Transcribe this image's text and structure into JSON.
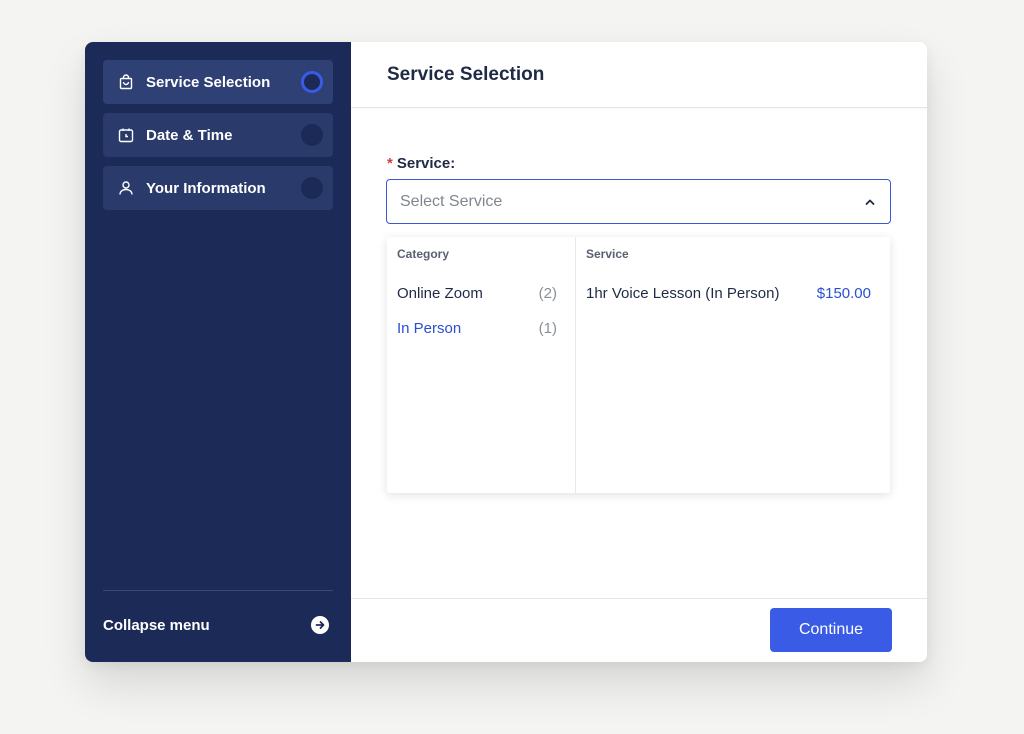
{
  "sidebar": {
    "steps": [
      {
        "label": "Service Selection",
        "icon": "shopping-bag-icon",
        "active": true
      },
      {
        "label": "Date & Time",
        "icon": "calendar-clock-icon",
        "active": false
      },
      {
        "label": "Your Information",
        "icon": "user-icon",
        "active": false
      }
    ],
    "collapse_label": "Collapse menu",
    "collapse_icon": "arrow-right-circle-icon"
  },
  "header": {
    "title": "Service Selection"
  },
  "form": {
    "required_mark": "*",
    "service_label": "Service:",
    "service_placeholder": "Select Service",
    "dropdown_icon": "chevron-up-icon"
  },
  "dropdown": {
    "category_header": "Category",
    "service_header": "Service",
    "categories": [
      {
        "name": "Online Zoom",
        "count": "(2)",
        "selected": false
      },
      {
        "name": "In Person",
        "count": "(1)",
        "selected": true
      }
    ],
    "services": [
      {
        "name": "1hr Voice Lesson (In Person)",
        "price": "$150.00"
      }
    ]
  },
  "footer": {
    "continue_label": "Continue"
  },
  "colors": {
    "sidebar_bg": "#1b2a57",
    "accent": "#3a5be6",
    "link": "#2a4fd1",
    "required": "#d23f3f"
  }
}
